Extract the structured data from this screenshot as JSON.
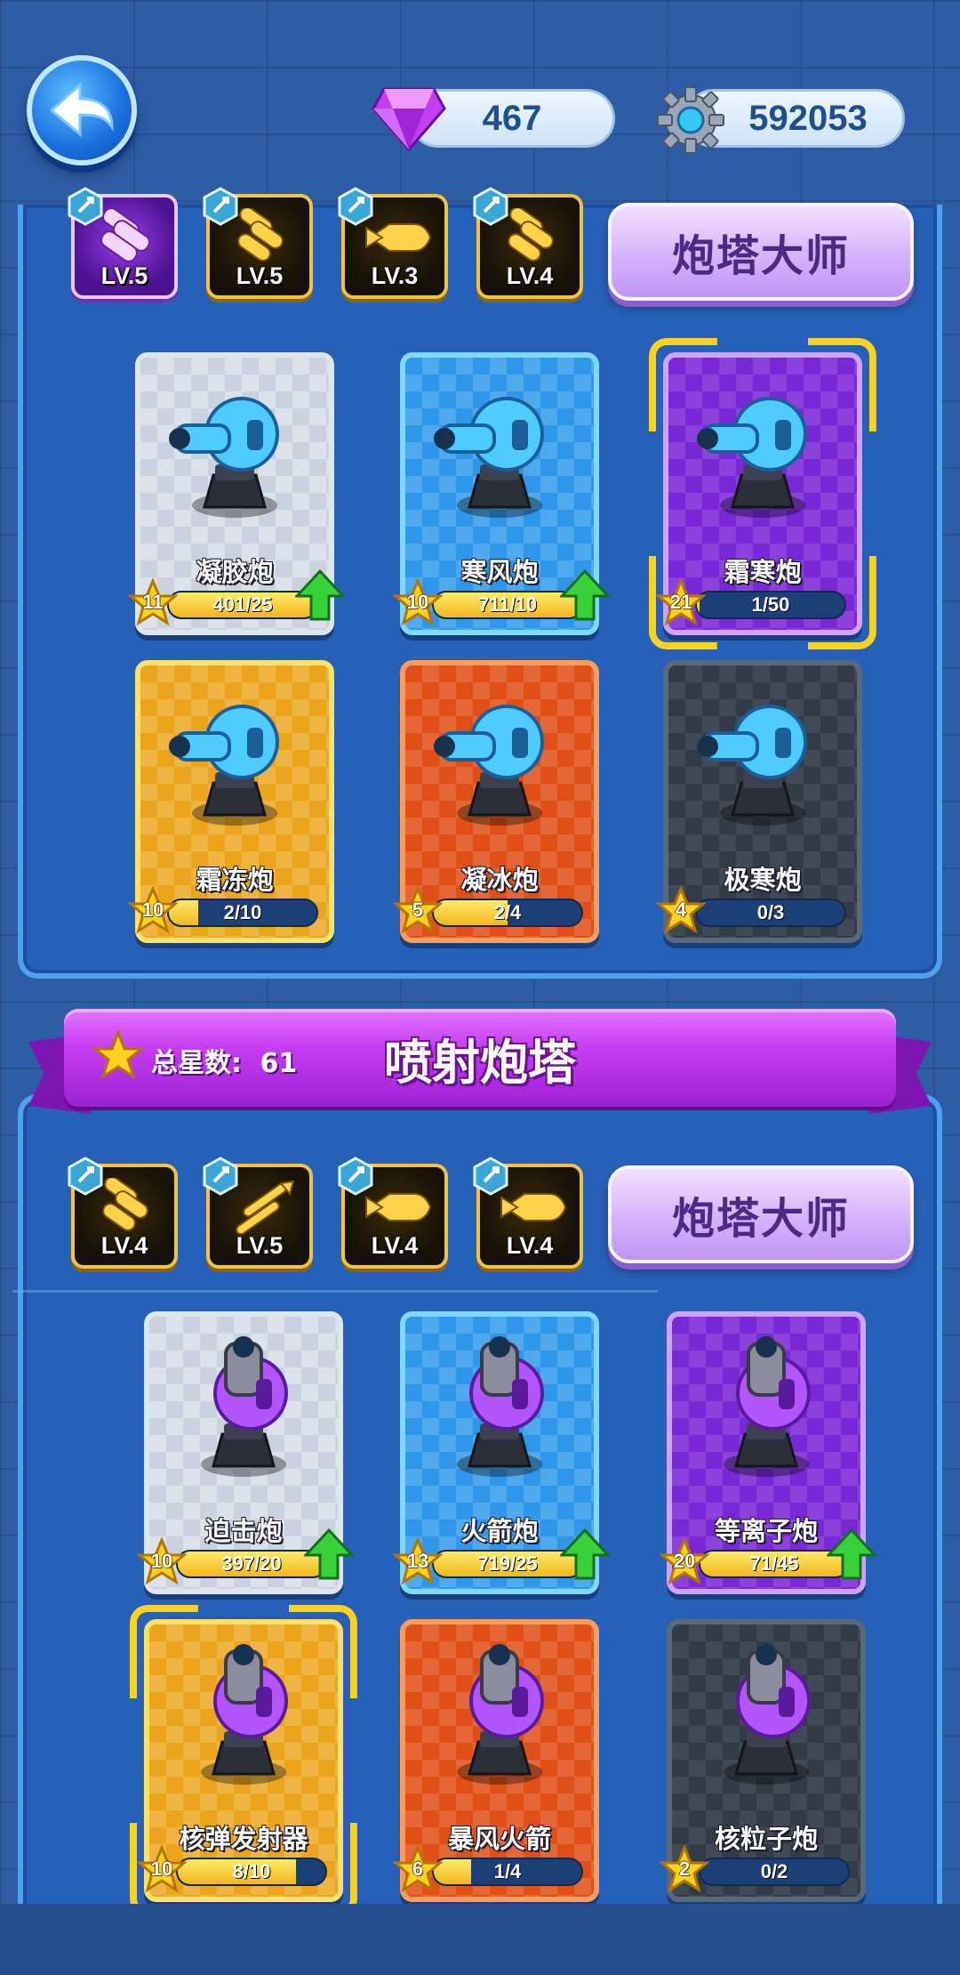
{
  "currency": {
    "gems": "467",
    "gears": "592053"
  },
  "section1": {
    "skills": [
      {
        "level": "LV.5",
        "style": "purple"
      },
      {
        "level": "LV.5",
        "style": "gold"
      },
      {
        "level": "LV.3",
        "style": "gold"
      },
      {
        "level": "LV.4",
        "style": "gold"
      }
    ],
    "master_label": "炮塔大师",
    "cards": [
      {
        "name": "凝胶炮",
        "stars": "11",
        "progress": "401/25",
        "fill": 1.0,
        "upgrade": true,
        "color": "gray"
      },
      {
        "name": "寒风炮",
        "stars": "10",
        "progress": "711/10",
        "fill": 1.0,
        "upgrade": true,
        "color": "blue"
      },
      {
        "name": "霜寒炮",
        "stars": "21",
        "progress": "1/50",
        "fill": 0.02,
        "upgrade": false,
        "color": "purple"
      },
      {
        "name": "霜冻炮",
        "stars": "10",
        "progress": "2/10",
        "fill": 0.2,
        "upgrade": false,
        "color": "gold"
      },
      {
        "name": "凝冰炮",
        "stars": "5",
        "progress": "2/4",
        "fill": 0.5,
        "upgrade": false,
        "color": "red"
      },
      {
        "name": "极寒炮",
        "stars": "4",
        "progress": "0/3",
        "fill": 0.0,
        "upgrade": false,
        "color": "dark"
      }
    ]
  },
  "section2": {
    "ribbon_title": "喷射炮塔",
    "total_stars_label": "总星数:",
    "total_stars_value": "61",
    "skills": [
      {
        "level": "LV.4",
        "style": "gold"
      },
      {
        "level": "LV.5",
        "style": "gold"
      },
      {
        "level": "LV.4",
        "style": "gold"
      },
      {
        "level": "LV.4",
        "style": "gold"
      }
    ],
    "master_label": "炮塔大师",
    "cards": [
      {
        "name": "迫击炮",
        "stars": "10",
        "progress": "397/20",
        "fill": 1.0,
        "upgrade": true,
        "color": "gray"
      },
      {
        "name": "火箭炮",
        "stars": "13",
        "progress": "719/25",
        "fill": 1.0,
        "upgrade": true,
        "color": "blue"
      },
      {
        "name": "等离子炮",
        "stars": "20",
        "progress": "71/45",
        "fill": 1.0,
        "upgrade": true,
        "color": "purple"
      },
      {
        "name": "核弹发射器",
        "stars": "10",
        "progress": "8/10",
        "fill": 0.8,
        "upgrade": false,
        "color": "gold"
      },
      {
        "name": "暴风火箭",
        "stars": "6",
        "progress": "1/4",
        "fill": 0.25,
        "upgrade": false,
        "color": "red"
      },
      {
        "name": "核粒子炮",
        "stars": "2",
        "progress": "0/2",
        "fill": 0.0,
        "upgrade": false,
        "color": "dark"
      }
    ]
  },
  "colors": {
    "accent_gold": "#ffd21f",
    "panel_blue": "#2760b8",
    "ribbon_purple": "#c53df0"
  }
}
